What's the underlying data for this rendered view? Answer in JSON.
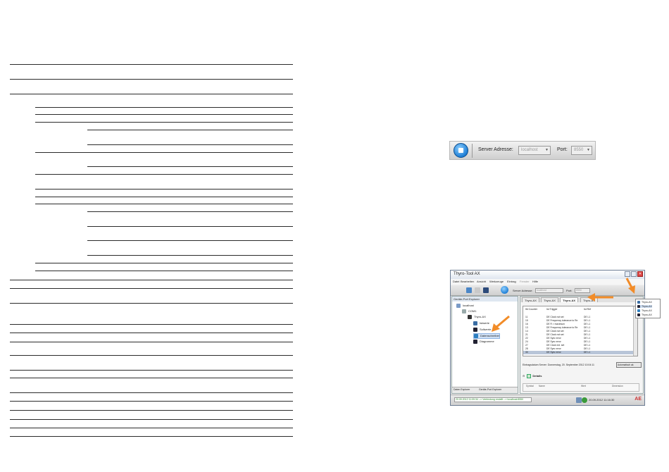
{
  "toolbar_snippet": {
    "server_label": "Server Adresse:",
    "server_value": "localhost",
    "port_label": "Port:",
    "port_value": "8550"
  },
  "app": {
    "title": "Thyro-Tool AX",
    "menu": [
      "Datei",
      "Bearbeiten",
      "Ansicht",
      "Werkzeuge",
      "Eintrag",
      "Fenster",
      "Hilfe"
    ],
    "toolbar": {
      "server_label": "Server Adresse:",
      "server_value": "localhost",
      "port_label": "Port:",
      "port_value": "8550"
    },
    "left_panel": {
      "header": "Geräte-Port Explorer",
      "tree": [
        "localhost",
        "COM1",
        "Thyro-AX",
        "Istwerte",
        "Sollwerte",
        "Datenschreiber",
        "Diagramme"
      ],
      "tabs": [
        "Daten Explorer",
        "Geräte-Port Explorer"
      ]
    },
    "doc_tabs": [
      "Thyro-AX",
      "Thyro-AX",
      "Thyro-AX",
      "Thyro-AX"
    ],
    "grid": {
      "headers": [
        "lfd Counter",
        "Ist Trigger",
        "Ist Ref"
      ],
      "rows": [
        [
          "11",
          "DE Clock not set",
          "DE L1"
        ],
        [
          "15",
          "DE Frequency tolerance to Re",
          "DE L1"
        ],
        [
          "16",
          "DE R > maximum",
          "DE L1"
        ],
        [
          "13",
          "DE Frequency tolerance to Re",
          "DE L1"
        ],
        [
          "14",
          "DE Clock not set",
          "DE L1"
        ],
        [
          "21",
          "DE Clock not set",
          "DE L1"
        ],
        [
          "22",
          "DE Sync error",
          "DE L1"
        ],
        [
          "24",
          "DE Sync error",
          "DE L1"
        ],
        [
          "27",
          "DE Clock ext. set",
          "DE L1"
        ],
        [
          "28",
          "DE Sync error",
          "DE L1"
        ],
        [
          "30",
          "DE Sync error",
          "DE L1"
        ]
      ]
    },
    "info_label": "Eintragsdatum Server:",
    "info_value": "Donnerstag, 20. September 2012 10:04:11",
    "auto_button": "Automatisch ak",
    "details_label": "Details",
    "detail_headers": [
      "Symbol",
      "Name",
      "Wert",
      "Dimension"
    ],
    "status_text": "20.09.2012 11:09:34 --> Verbindung erstellt --> localhost:8550",
    "status_time": "20.09.2012 11:16:30",
    "logo": "AE",
    "dropdown": [
      "Thyro-AX",
      "Thyro-AX",
      "Thyro-AX",
      "Thyro-AX"
    ]
  },
  "colors": {
    "arrow": "#f28c28",
    "status_text": "#2a8a2a",
    "accent": "#1f7fd6"
  }
}
